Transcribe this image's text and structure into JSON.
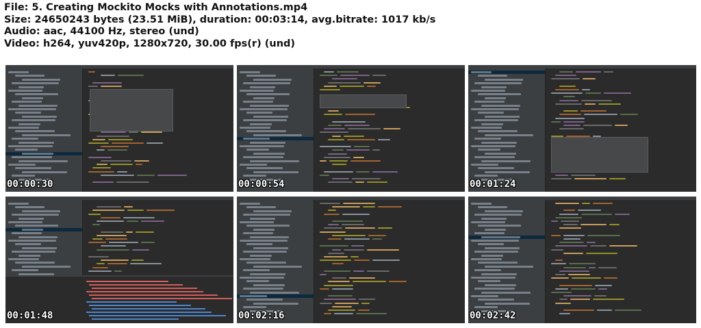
{
  "info": {
    "file": "File: 5. Creating Mockito Mocks with Annotations.mp4",
    "size": "Size: 24650243 bytes (23.51 MiB), duration: 00:03:14, avg.bitrate: 1017 kb/s",
    "audio": "Audio: aac, 44100 Hz, stereo (und)",
    "video": "Video: h264, yuv420p, 1280x720, 30.00 fps(r) (und)"
  },
  "thumbnails": [
    {
      "timestamp": "00:00:30"
    },
    {
      "timestamp": "00:00:54"
    },
    {
      "timestamp": "00:01:24"
    },
    {
      "timestamp": "00:01:48"
    },
    {
      "timestamp": "00:02:16"
    },
    {
      "timestamp": "00:02:42"
    }
  ]
}
